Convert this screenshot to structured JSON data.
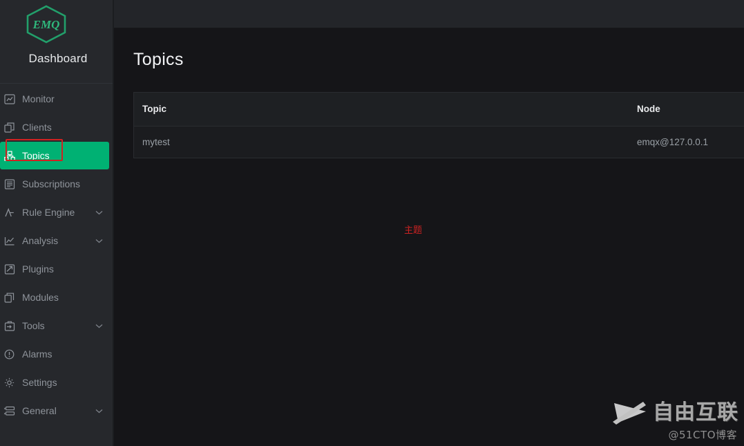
{
  "colors": {
    "sidebar_bg": "#26282c",
    "content_bg": "#151518",
    "topbar_bg": "#232529",
    "accent_green": "#00b173",
    "annotation_red": "#d02222",
    "table_header_bg": "#1e2023",
    "table_row_bg": "#1b1c1f"
  },
  "sidebar": {
    "logo_text": "EMQ",
    "logo_icon": "emq-hexagon-logo",
    "title": "Dashboard",
    "items": [
      {
        "label": "Monitor",
        "icon": "monitor-icon",
        "expandable": false,
        "active": false
      },
      {
        "label": "Clients",
        "icon": "clients-icon",
        "expandable": false,
        "active": false
      },
      {
        "label": "Topics",
        "icon": "topics-icon",
        "expandable": false,
        "active": true
      },
      {
        "label": "Subscriptions",
        "icon": "subscriptions-icon",
        "expandable": false,
        "active": false
      },
      {
        "label": "Rule Engine",
        "icon": "rule-engine-icon",
        "expandable": true,
        "active": false
      },
      {
        "label": "Analysis",
        "icon": "analysis-icon",
        "expandable": true,
        "active": false
      },
      {
        "label": "Plugins",
        "icon": "plugins-icon",
        "expandable": false,
        "active": false
      },
      {
        "label": "Modules",
        "icon": "modules-icon",
        "expandable": false,
        "active": false
      },
      {
        "label": "Tools",
        "icon": "tools-icon",
        "expandable": true,
        "active": false
      },
      {
        "label": "Alarms",
        "icon": "alarms-icon",
        "expandable": false,
        "active": false
      },
      {
        "label": "Settings",
        "icon": "settings-gear-icon",
        "expandable": false,
        "active": false
      },
      {
        "label": "General",
        "icon": "general-icon",
        "expandable": true,
        "active": false
      }
    ]
  },
  "main": {
    "page_title": "Topics",
    "table": {
      "columns": [
        "Topic",
        "Node"
      ],
      "rows": [
        {
          "topic": "mytest",
          "node": "emqx@127.0.0.1"
        }
      ]
    }
  },
  "annotations": {
    "topics_label": "主题"
  },
  "watermark": {
    "brand": "自由互联",
    "handle": "@51CTO博客",
    "logo_icon": "x-swoosh-logo"
  }
}
